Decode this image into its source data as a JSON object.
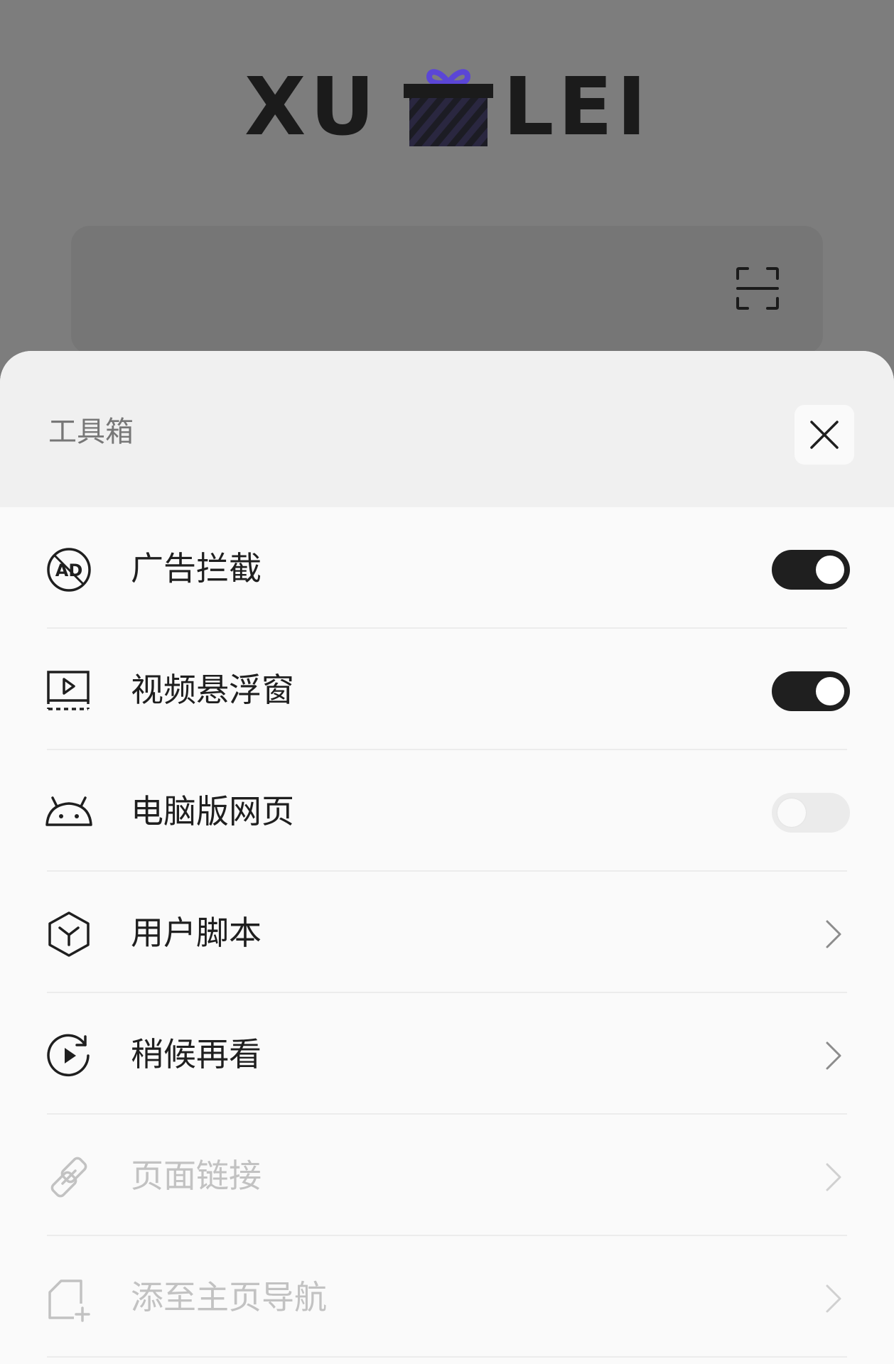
{
  "background": {
    "logo": {
      "left_text": "XU",
      "right_text": "LEI"
    }
  },
  "sheet": {
    "title": "工具箱",
    "items": [
      {
        "label": "广告拦截",
        "icon": "ad-block-icon",
        "control": "toggle",
        "enabled": true
      },
      {
        "label": "视频悬浮窗",
        "icon": "floating-video-icon",
        "control": "toggle",
        "enabled": true
      },
      {
        "label": "电脑版网页",
        "icon": "android-icon",
        "control": "toggle",
        "enabled": false
      },
      {
        "label": "用户脚本",
        "icon": "cube-icon",
        "control": "chevron"
      },
      {
        "label": "稍候再看",
        "icon": "watch-later-icon",
        "control": "chevron"
      },
      {
        "label": "页面链接",
        "icon": "link-icon",
        "control": "chevron",
        "disabled": true
      },
      {
        "label": "添至主页导航",
        "icon": "add-to-home-icon",
        "control": "chevron",
        "disabled": true
      }
    ]
  },
  "colors": {
    "toggle_on": "#1f1f1f",
    "toggle_off": "#ebebeb",
    "gift_accent": "#5b46d6"
  }
}
